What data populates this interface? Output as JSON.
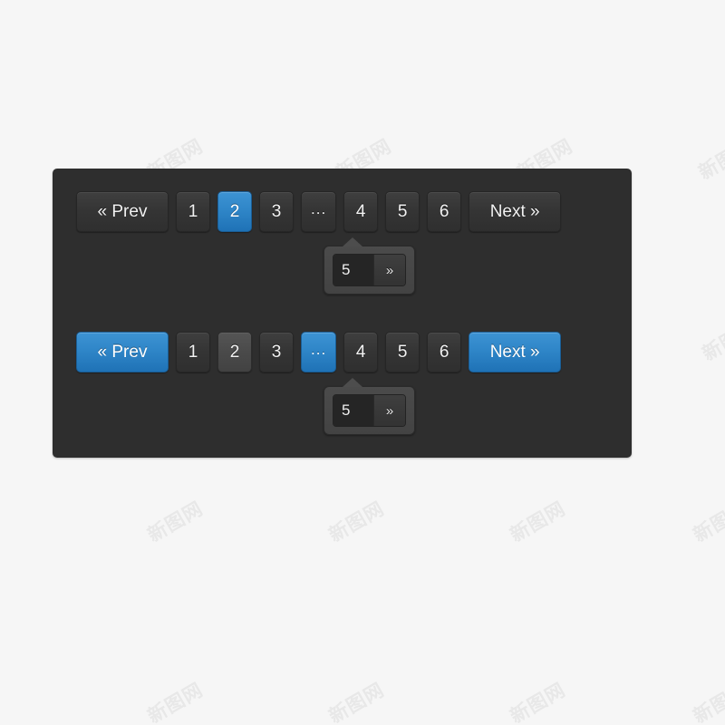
{
  "colors": {
    "page_background": "#f6f6f6",
    "panel_background": "#2e2e2e",
    "button_default": "#343434",
    "button_hover": "#4a4a4a",
    "accent_blue": "#2f86c8",
    "text": "#f2f2f2"
  },
  "watermark": {
    "text": "新图网"
  },
  "panel": {
    "rows": [
      {
        "name": "pagination-default",
        "buttons": [
          {
            "label": "« Prev",
            "state": "default",
            "wide": true,
            "kind": "prev"
          },
          {
            "label": "1",
            "state": "default",
            "wide": false,
            "kind": "page"
          },
          {
            "label": "2",
            "state": "active",
            "wide": false,
            "kind": "page"
          },
          {
            "label": "3",
            "state": "default",
            "wide": false,
            "kind": "page"
          },
          {
            "label": "...",
            "state": "default",
            "wide": false,
            "kind": "ellipsis"
          },
          {
            "label": "4",
            "state": "default",
            "wide": false,
            "kind": "page"
          },
          {
            "label": "5",
            "state": "default",
            "wide": false,
            "kind": "page"
          },
          {
            "label": "6",
            "state": "default",
            "wide": false,
            "kind": "page"
          },
          {
            "label": "Next »",
            "state": "default",
            "wide": true,
            "kind": "next"
          }
        ],
        "popup": {
          "input_value": "5",
          "input_placeholder": "",
          "go_label": "»"
        }
      },
      {
        "name": "pagination-hover",
        "buttons": [
          {
            "label": "« Prev",
            "state": "active",
            "wide": true,
            "kind": "prev"
          },
          {
            "label": "1",
            "state": "default",
            "wide": false,
            "kind": "page"
          },
          {
            "label": "2",
            "state": "hover",
            "wide": false,
            "kind": "page"
          },
          {
            "label": "3",
            "state": "default",
            "wide": false,
            "kind": "page"
          },
          {
            "label": "...",
            "state": "active",
            "wide": false,
            "kind": "ellipsis"
          },
          {
            "label": "4",
            "state": "default",
            "wide": false,
            "kind": "page"
          },
          {
            "label": "5",
            "state": "default",
            "wide": false,
            "kind": "page"
          },
          {
            "label": "6",
            "state": "default",
            "wide": false,
            "kind": "page"
          },
          {
            "label": "Next »",
            "state": "active",
            "wide": true,
            "kind": "next"
          }
        ],
        "popup": {
          "input_value": "5",
          "input_placeholder": "",
          "go_label": "»"
        }
      }
    ]
  }
}
